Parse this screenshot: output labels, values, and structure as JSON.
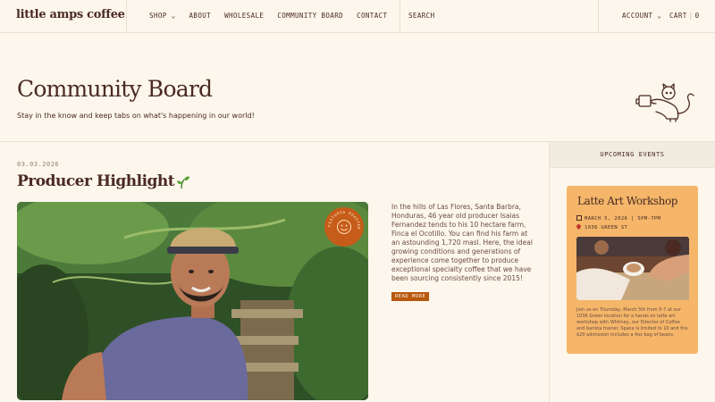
{
  "brand": {
    "logo": "little amps coffee"
  },
  "nav": {
    "items": [
      "SHOP ⌄",
      "ABOUT",
      "WHOLESALE",
      "COMMUNITY BOARD",
      "CONTACT"
    ],
    "search": "SEARCH",
    "account": "ACCOUNT ⌄",
    "cart_label": "CART",
    "cart_count": "0"
  },
  "hero": {
    "title": "Community Board",
    "subtitle": "Stay in the know and keep tabs on what's happening in our world!"
  },
  "article": {
    "date": "03.03.2026",
    "title": "Producer Highlight",
    "badge_text": "FEATURED ROASTER",
    "body": "In the hills of Las Flores, Santa Barbra, Honduras, 46 year old producer Isaias Fernandez tends to his 10 hectare farm, Finca el Ocotillo. You can find his farm at an astounding 1,720 masl. Here, the ideal growing conditions and generations of experience come together to produce exceptional specialty coffee that we have been sourcing consistently since 2015!",
    "read_more": "READ MORE"
  },
  "sidebar": {
    "heading": "UPCOMING EVENTS",
    "event": {
      "title": "Latte Art Workshop",
      "date_line": "MARCH 5, 2026 | 5PM-7PM",
      "address": "1036 GREEN ST",
      "description": "Join us on Thursday, March 5th from 5-7 at our 1036 Green location for a hands on latte art workshop with Whitney, our Director of Coffee and barista trainer. Space is limited to 10 and the $20 admission includes a 4oz bag of beans."
    }
  },
  "colors": {
    "background": "#fdf6ec",
    "text": "#4a2a22",
    "accent_orange": "#c65c19",
    "event_card": "#f5b66a"
  }
}
